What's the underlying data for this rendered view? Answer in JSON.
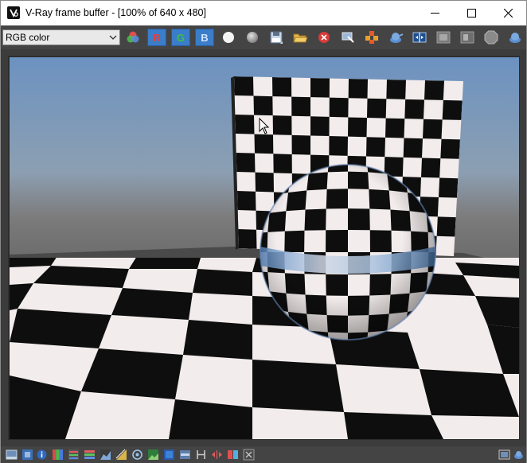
{
  "window": {
    "title": "V-Ray frame buffer - [100% of 640 x 480]"
  },
  "toolbar": {
    "channel_select": {
      "value": "RGB color"
    },
    "channel_buttons": [
      {
        "label": "R",
        "color": "#e04040"
      },
      {
        "label": "G",
        "color": "#40c040"
      },
      {
        "label": "B",
        "color": "#d0e4ff"
      }
    ]
  },
  "icons": {
    "app": "vray-logo-icon",
    "minimize": "minimize-icon",
    "maximize": "maximize-icon",
    "close": "close-icon",
    "color_corrections": "color-corrections-icon",
    "white_dot": "view-white-icon",
    "gray_dot": "view-gray-icon",
    "save": "save-image-icon",
    "open": "open-image-icon",
    "clear": "clear-image-icon",
    "track_mouse": "track-mouse-icon",
    "region_render": "region-render-icon",
    "render_last": "render-last-icon",
    "compare": "compare-icon",
    "lens_effects": "lens-effects-icon",
    "history": "history-icon",
    "stop": "stop-render-icon",
    "ipr": "interactive-render-icon"
  },
  "colors": {
    "toolbar_bg": "#444444",
    "channel_button_bg": "#3a7dc9",
    "sky_top": "#6c92c0",
    "floor_white": "#f3ecec",
    "floor_black": "#0e0e0e"
  }
}
